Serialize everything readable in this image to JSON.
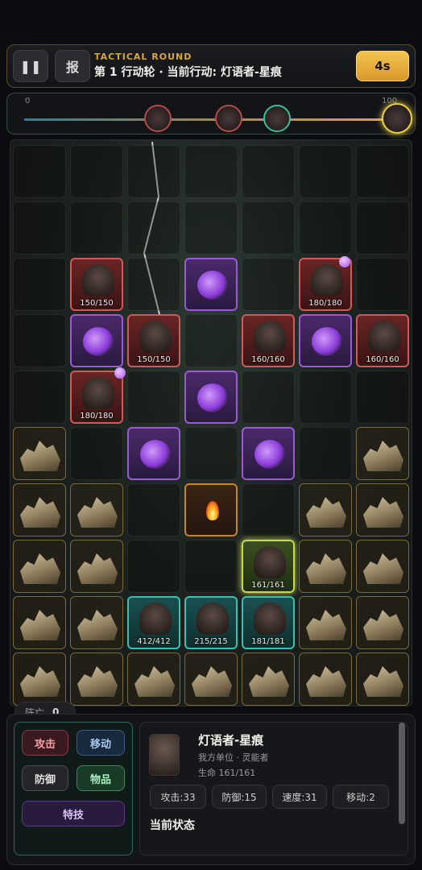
{
  "topbar": {
    "pause_icon": "pause-icon",
    "report_label": "报",
    "round_subtitle": "TACTICAL ROUND",
    "round_title": "第 1 行动轮 · 当前行动: 灯语者-星痕",
    "timer": "4s"
  },
  "timeline": {
    "min_label": "0",
    "max_label": "100",
    "tokens": [
      "werewolf-token",
      "werewolf-token",
      "sniper-token",
      "lantern-speaker-token"
    ]
  },
  "board": {
    "units": [
      {
        "type": "enemy",
        "hp": "150/150"
      },
      {
        "type": "enemy",
        "hp": "180/180"
      },
      {
        "type": "enemy",
        "hp": "150/150"
      },
      {
        "type": "enemy",
        "hp": "160/160"
      },
      {
        "type": "enemy",
        "hp": "160/160"
      },
      {
        "type": "enemy",
        "hp": "180/180"
      },
      {
        "type": "ally-active",
        "hp": "161/161"
      },
      {
        "type": "ally",
        "hp": "412/412"
      },
      {
        "type": "ally",
        "hp": "215/215"
      },
      {
        "type": "ally",
        "hp": "181/181"
      }
    ]
  },
  "deaths": {
    "label": "阵亡",
    "count": "0"
  },
  "actions": {
    "attack": "攻击",
    "move": "移动",
    "defend": "防御",
    "items": "物品",
    "skill": "特技"
  },
  "unit_info": {
    "name": "灯语者-星痕",
    "subtitle": "我方单位 · 灵能者",
    "hp": "生命 161/161",
    "stats": [
      "攻击:33",
      "防御:15",
      "速度:31",
      "移动:2"
    ],
    "state_title": "当前状态"
  },
  "colors": {
    "accent": "#d9a63a",
    "enemy": "#d05a5a",
    "ally": "#3ac0b0",
    "fog": "#9a5ad8"
  }
}
